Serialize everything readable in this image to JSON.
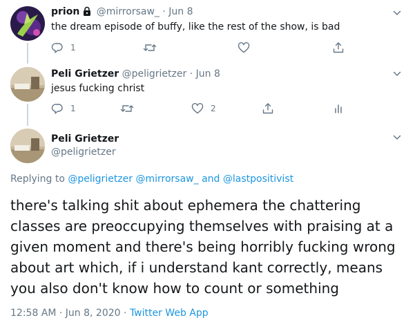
{
  "tweets": [
    {
      "name": "prion",
      "handle": "@mirrorsaw_",
      "separator": "·",
      "date": "Jun 8",
      "text": "the dream episode of buffy, like the rest of the show, is bad",
      "reply_count": "1",
      "retweet_count": "",
      "like_count": "",
      "locked": true
    },
    {
      "name": "Peli Grietzer",
      "handle": "@peligrietzer",
      "separator": "·",
      "date": "Jun 8",
      "text": "jesus fucking christ",
      "reply_count": "1",
      "retweet_count": "",
      "like_count": "2"
    }
  ],
  "main_tweet": {
    "name": "Peli Grietzer",
    "handle": "@peligrietzer",
    "replying_prefix": "Replying to",
    "replying_users": [
      "@peligrietzer",
      "@mirrorsaw_",
      "@lastpositivist"
    ],
    "replying_and": "and",
    "text": "there's talking shit about ephemera the chattering classes are preoccupying themselves with praising at a given moment and there's being horribly fucking wrong about art which, if i understand kant correctly, means you also don't know how to count or something",
    "timestamp": "12:58 AM · Jun 8, 2020",
    "separator": "·",
    "source": "Twitter Web App"
  },
  "icons": {
    "lock": "lock-icon",
    "caret": "chevron-down-icon",
    "reply": "reply-icon",
    "retweet": "retweet-icon",
    "like": "heart-icon",
    "share": "share-icon",
    "analytics": "analytics-icon"
  },
  "colors": {
    "text": "#14171a",
    "secondary": "#657786",
    "link": "#1b95e0",
    "thread_line": "#ccd6dd"
  }
}
